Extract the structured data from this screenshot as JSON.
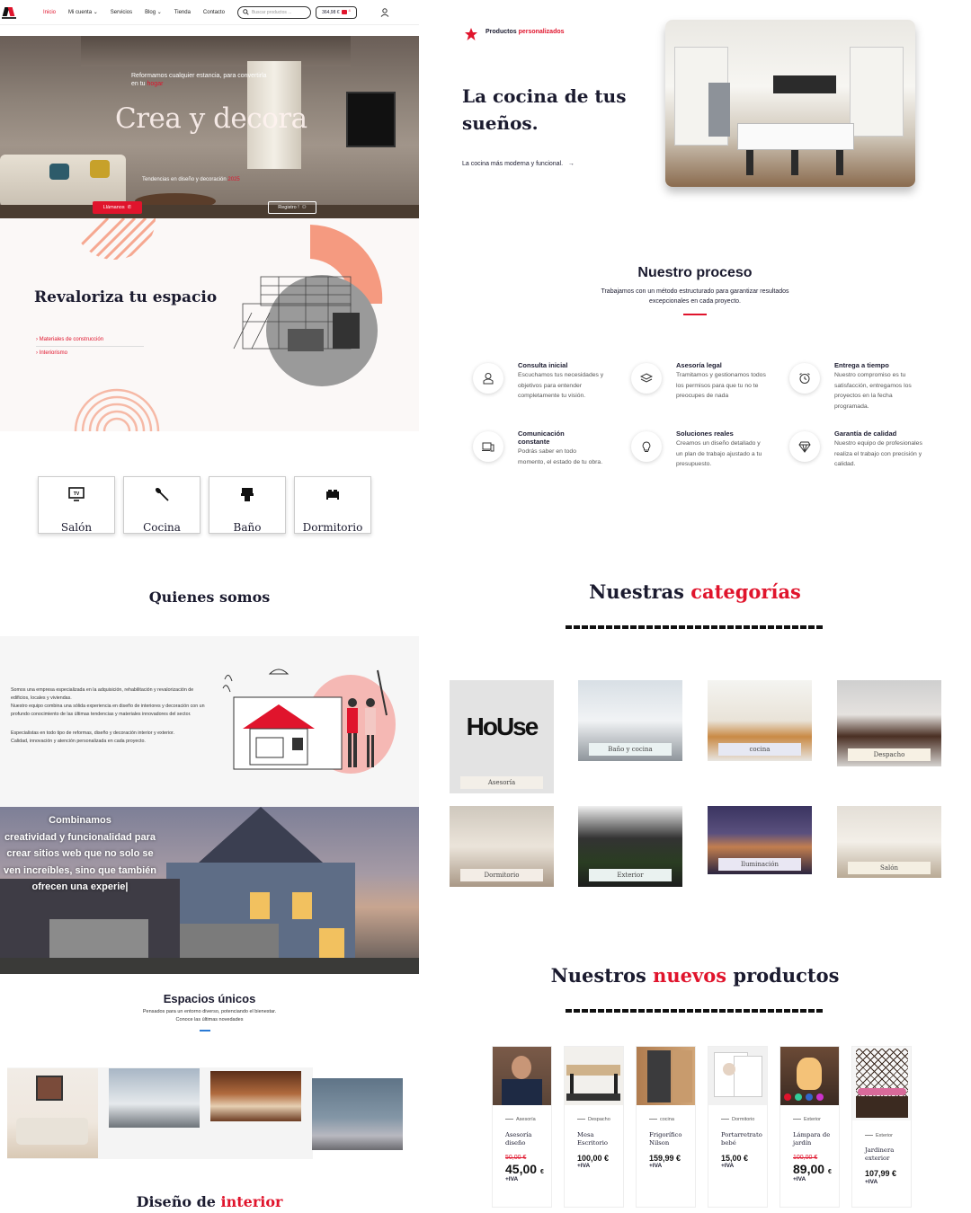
{
  "nav": {
    "items": [
      "Inicio",
      "Mi cuenta",
      "Servicios",
      "Blog",
      "Tienda",
      "Contacto"
    ],
    "search_placeholder": "Buscar productos ...",
    "cart_total": "364,98 €",
    "cart_count": "4"
  },
  "hero": {
    "line1": "Reformamos cualquier estancia, para convertirla",
    "line2_pre": "en tu ",
    "line2_red": "hogar",
    "title": "Crea y decora",
    "trend_pre": "Tendencias en diseño y decoración ",
    "trend_year": "2025",
    "btn_call": "Llámanos",
    "btn_register": "Registro !"
  },
  "revaloriza": {
    "title": "Revaloriza tu espacio",
    "links": [
      "Materiales de construcción",
      "Interiorismo"
    ]
  },
  "rooms": [
    {
      "label": "Salón",
      "icon": "tv-icon"
    },
    {
      "label": "Cocina",
      "icon": "spatula-icon"
    },
    {
      "label": "Baño",
      "icon": "toothbrush-icon"
    },
    {
      "label": "Dormitorio",
      "icon": "bed-icon"
    }
  ],
  "quienes": {
    "title": "Quienes somos",
    "paragraphs": [
      "Somos una empresa especializada en la adquisición, rehabilitación y revalorización de edificios, locales y viviendas.",
      "Nuestro equipo combina una sólida experiencia en diseño de interiores y decoración con un profundo conocimiento de las últimas tendencias y materiales innovadores del sector.",
      "Especialistas en todo tipo de reformas, diseño y decoración interior y exterior.",
      "Calidad, innovación y atención personalizada en cada proyecto."
    ]
  },
  "banner": {
    "text_lines": [
      "Combinamos",
      "creatividad y funcionalidad para",
      "crear sitios web que no solo se",
      "ven increíbles, sino que también",
      "ofrecen una experie|"
    ]
  },
  "espacios": {
    "title": "Espacios únicos",
    "subtitle_l1": "Pensados para un entorno diverso, potenciando el bienestar.",
    "subtitle_l2": "Conoce las últimas novedades"
  },
  "diseno": {
    "pre": "Diseño de ",
    "red": "interior"
  },
  "kitchen": {
    "label_pre": "Productos ",
    "label_red": "personalizados",
    "title_l1": "La cocina de tus",
    "title_l2": "sueños.",
    "link": "La cocina más moderna y funcional.",
    "arrow": "→"
  },
  "proceso": {
    "title": "Nuestro proceso",
    "subtitle_l1": "Trabajamos con un método estructurado para garantizar resultados",
    "subtitle_l2": "excepcionales en cada proyecto.",
    "steps": [
      {
        "title": "Consulta inicial",
        "desc": "Escuchamos tus necesidades y objetivos para entender completamente tu visión.",
        "icon": "user-icon"
      },
      {
        "title": "Asesoría legal",
        "desc": "Tramitamos y gestionamos todos los permisos para que tu no te preocupes de nada",
        "icon": "layers-icon"
      },
      {
        "title": "Entrega a tiempo",
        "desc": "Nuestro compromiso es tu satisfacción, entregamos los proyectos en la fecha programada.",
        "icon": "alarm-clock-icon"
      },
      {
        "title": "Comunicación constante",
        "desc": "Podrás saber en todo momento, el estado de tu obra.",
        "icon": "devices-icon"
      },
      {
        "title": "Soluciones reales",
        "desc": "Creamos un diseño detallado y un plan de trabajo ajustado a tu presupuesto.",
        "icon": "lightbulb-icon"
      },
      {
        "title": "Garantía de calidad",
        "desc": "Nuestro equipo de profesionales realiza el trabajo con precisión y calidad.",
        "icon": "diamond-icon"
      }
    ]
  },
  "categorias": {
    "title_pre": "Nuestras ",
    "title_red": "categorías",
    "house_logo": "HoUse",
    "items": [
      "Asesoría",
      "Baño y cocina",
      "cocina",
      "Despacho",
      "Dormitorio",
      "Exterior",
      "Iluminación",
      "Salón"
    ]
  },
  "productos": {
    "title_pre": "Nuestros ",
    "title_red": "nuevos",
    "title_post": " productos",
    "items": [
      {
        "category": "Asesoría",
        "name": "Asesoría diseño",
        "old": "50,00 €",
        "price": "45,00",
        "currency": "€",
        "iva": "+IVA"
      },
      {
        "category": "Despacho",
        "name": "Mesa Escritorio",
        "old": "",
        "price": "100,00 €",
        "currency": "",
        "iva": "+IVA"
      },
      {
        "category": "cocina",
        "name": "Frigorífico Nilson",
        "old": "",
        "price": "159,99 €",
        "currency": "",
        "iva": "+IVA"
      },
      {
        "category": "Dormitorio",
        "name": "Portarretrato bebé",
        "old": "",
        "price": "15,00 €",
        "currency": "",
        "iva": "+IVA"
      },
      {
        "category": "Exterior",
        "name": "Lámpara de jardín",
        "old": "100,00 €",
        "price": "89,00",
        "currency": "€",
        "iva": "+IVA"
      },
      {
        "category": "Exterior",
        "name": "Jardinera exterior",
        "old": "",
        "price": "107,99 €",
        "currency": "",
        "iva": "+IVA"
      }
    ]
  },
  "colors": {
    "accent": "#e0142c",
    "text": "#1b1b2f"
  }
}
